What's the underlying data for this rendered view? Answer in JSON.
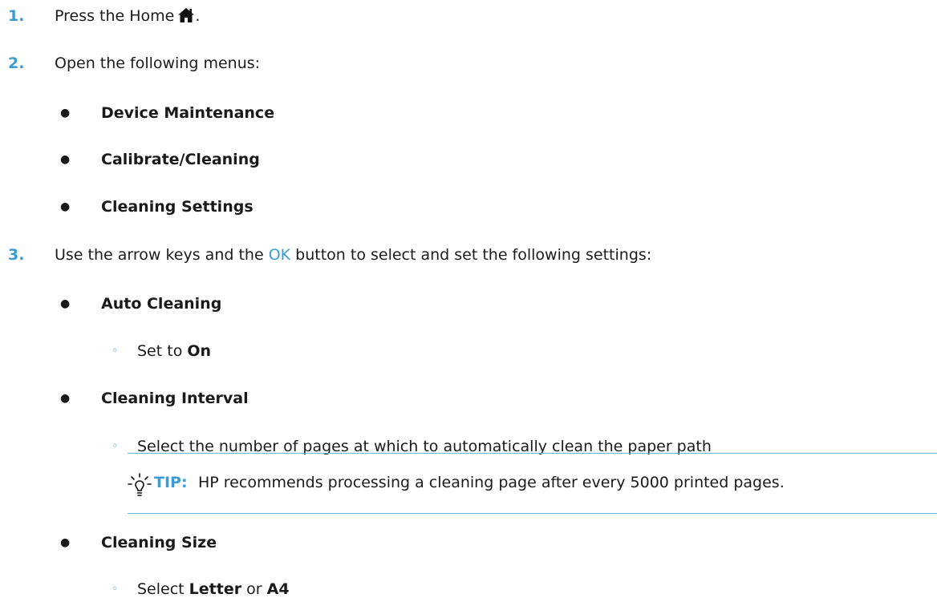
{
  "step1": {
    "number": "1.",
    "text": "Press the Home",
    "suffix": ".",
    "icon": "home-icon"
  },
  "step2": {
    "number": "2.",
    "text": "Open the following menus:",
    "items": [
      "Device Maintenance",
      "Calibrate/Cleaning",
      "Cleaning Settings"
    ]
  },
  "step3": {
    "number": "3.",
    "text_before": "Use the arrow keys and the",
    "ok_label": "OK",
    "text_after": "button to select and set the following settings:",
    "settings": [
      {
        "name": "Auto Cleaning",
        "detail_prefix": "Set to",
        "detail_bold": "On"
      },
      {
        "name": "Cleaning Interval",
        "detail": "Select the number of pages at which to automatically clean the paper path"
      },
      {
        "name": "Cleaning Size",
        "detail_prefix": "Select",
        "detail_bold1": "Letter",
        "detail_mid": "or",
        "detail_bold2": "A4"
      }
    ]
  },
  "tip": {
    "label": "TIP:",
    "text": "HP recommends processing a cleaning page after every 5000 printed pages.",
    "icon": "lightbulb-icon"
  },
  "colors": {
    "accent": "#3b9bd4",
    "text": "#1a1a1a",
    "rule": "#6fb7de"
  }
}
